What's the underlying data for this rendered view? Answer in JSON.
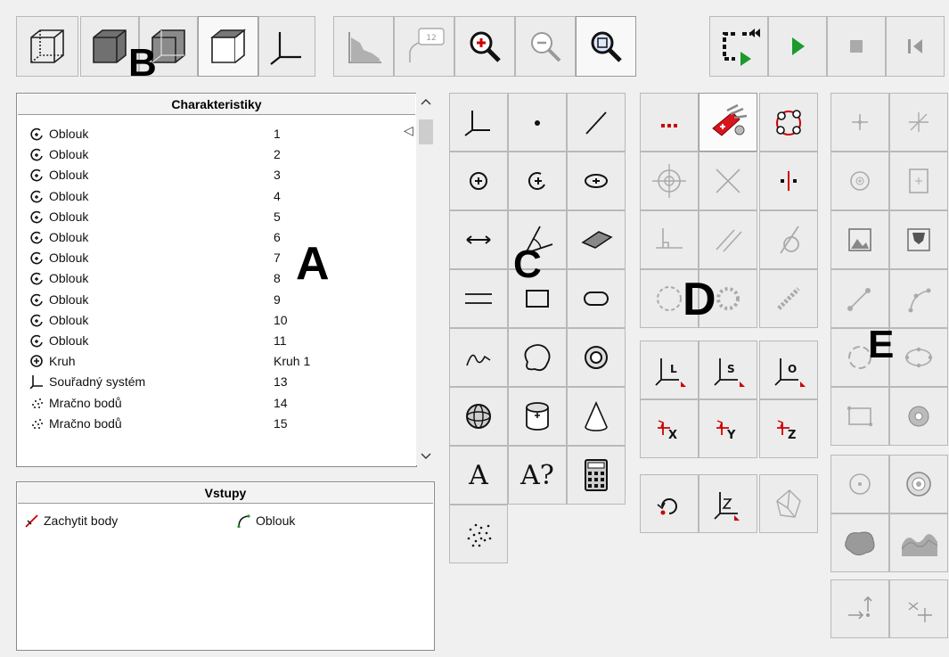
{
  "toolbar": {
    "view_buttons": [
      "wireframe-view",
      "shaded-view",
      "shaded-wire-view",
      "hidden-line-view",
      "coordinate-system-view"
    ],
    "tools": [
      "graph-tool",
      "label-tool",
      "zoom-in",
      "zoom-out",
      "zoom-fit"
    ],
    "playback": [
      "program-loop",
      "play",
      "stop",
      "step-back"
    ],
    "label_value": "12"
  },
  "characteristics": {
    "header": "Charakteristiky",
    "rows": [
      {
        "icon": "arc-icon",
        "name": "Oblouk",
        "value": "1"
      },
      {
        "icon": "arc-icon",
        "name": "Oblouk",
        "value": "2"
      },
      {
        "icon": "arc-icon",
        "name": "Oblouk",
        "value": "3"
      },
      {
        "icon": "arc-icon",
        "name": "Oblouk",
        "value": "4"
      },
      {
        "icon": "arc-icon",
        "name": "Oblouk",
        "value": "5"
      },
      {
        "icon": "arc-icon",
        "name": "Oblouk",
        "value": "6"
      },
      {
        "icon": "arc-icon",
        "name": "Oblouk",
        "value": "7"
      },
      {
        "icon": "arc-icon",
        "name": "Oblouk",
        "value": "8"
      },
      {
        "icon": "arc-icon",
        "name": "Oblouk",
        "value": "9"
      },
      {
        "icon": "arc-icon",
        "name": "Oblouk",
        "value": "10"
      },
      {
        "icon": "arc-icon",
        "name": "Oblouk",
        "value": "11"
      },
      {
        "icon": "circle-icon",
        "name": "Kruh",
        "value": "Kruh 1"
      },
      {
        "icon": "coordinate-system-icon",
        "name": "Souřadný systém",
        "value": "13"
      },
      {
        "icon": "point-cloud-icon",
        "name": "Mračno bodů",
        "value": "14"
      },
      {
        "icon": "point-cloud-icon",
        "name": "Mračno bodů",
        "value": "15"
      }
    ]
  },
  "inputs": {
    "header": "Vstupy",
    "items": [
      {
        "icon": "capture-points-icon",
        "label": "Zachytit body"
      },
      {
        "icon": "arc-input-icon",
        "label": "Oblouk"
      }
    ]
  },
  "labels": {
    "a": "A",
    "b": "B",
    "c": "C",
    "d": "D",
    "e": "E"
  },
  "text_tools": {
    "text": "A",
    "text_query": "A?"
  },
  "axis_tools": {
    "l": "L",
    "s": "S",
    "o": "O",
    "x": "X",
    "y": "Y",
    "z": "Z"
  }
}
